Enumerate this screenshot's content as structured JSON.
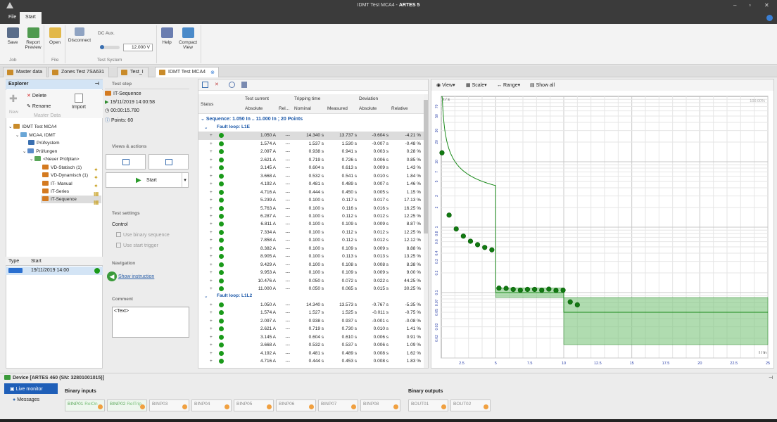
{
  "window": {
    "title_prefix": "IDMT Test MCA4 - ",
    "title_app": "ARTES 5"
  },
  "ribbon_tabs": [
    "File",
    "Start"
  ],
  "ribbon": {
    "save": "Save",
    "report": "Report\nPreview",
    "open": "Open",
    "disconnect": "Disconnect",
    "dcaux": "DC Aux.",
    "voltage": "12.000 V",
    "help": "Help",
    "compact": "Compact\nView",
    "groups": {
      "job": "Job",
      "file": "File",
      "test_system": "Test System"
    }
  },
  "doc_tabs": [
    "Master data",
    "Zones Test 7SA631",
    "Test_I",
    "IDMT Test MCA4"
  ],
  "explorer": {
    "title": "Explorer",
    "delete": "Delete",
    "rename": "Rename",
    "new": "New",
    "master_data": "Master Data",
    "import": "Import",
    "tree": [
      "IDMT Test MCA4",
      "MCA4, IDMT",
      "Prüfsystem",
      "Prüfungen",
      "<Neuer Prüfplan>",
      "VD-Statisch (1)",
      "VD-Dynamisch (1)",
      "IT- Manual",
      "IT-Series",
      "IT-Sequence"
    ],
    "list_head": {
      "type": "Type",
      "start": "Start"
    },
    "list_row": "19/11/2019 14:00"
  },
  "teststep": {
    "title": "Test step",
    "name": "IT-Sequence",
    "date": "19/11/2019 14:00:58",
    "time": "00:00:15.780",
    "points": "Points: 60"
  },
  "views": {
    "title": "Views & actions",
    "start": "Start"
  },
  "settings": {
    "title": "Test settings",
    "control": "Control",
    "binary": "Use binary sequence",
    "trigger": "Use start trigger"
  },
  "navigation": {
    "title": "Navigation",
    "show": "Show instruction"
  },
  "comment": {
    "title": "Comment",
    "text": "<Text>"
  },
  "table": {
    "status": "Status",
    "test_current": "Test current",
    "tripping_time": "Tripping time",
    "deviation": "Deviation",
    "absolute": "Absolute",
    "rel": "Rel...",
    "nominal": "Nominal",
    "measured": "Measured",
    "relative": "Relative",
    "sequence": "Sequence: 1.050 In .. 11.000 In ; 20 Points",
    "group1": "Fault loop: L1E",
    "group2": "Fault loop: L1L2",
    "rows1": [
      [
        "1.050 A",
        "14.340 s",
        "13.737 s",
        "-0.604 s",
        "-4.21 %"
      ],
      [
        "1.574 A",
        "1.537 s",
        "1.530 s",
        "-0.007 s",
        "-0.48 %"
      ],
      [
        "2.097 A",
        "0.938 s",
        "0.941 s",
        "0.003 s",
        "0.28 %"
      ],
      [
        "2.621 A",
        "0.719 s",
        "0.726 s",
        "0.006 s",
        "0.85 %"
      ],
      [
        "3.145 A",
        "0.604 s",
        "0.613 s",
        "0.009 s",
        "1.43 %"
      ],
      [
        "3.668 A",
        "0.532 s",
        "0.541 s",
        "0.010 s",
        "1.84 %"
      ],
      [
        "4.192 A",
        "0.481 s",
        "0.489 s",
        "0.007 s",
        "1.46 %"
      ],
      [
        "4.716 A",
        "0.444 s",
        "0.450 s",
        "0.005 s",
        "1.15 %"
      ],
      [
        "5.239 A",
        "0.100 s",
        "0.117 s",
        "0.017 s",
        "17.13 %"
      ],
      [
        "5.763 A",
        "0.100 s",
        "0.116 s",
        "0.016 s",
        "16.25 %"
      ],
      [
        "6.287 A",
        "0.100 s",
        "0.112 s",
        "0.012 s",
        "12.25 %"
      ],
      [
        "6.811 A",
        "0.100 s",
        "0.109 s",
        "0.009 s",
        "8.87 %"
      ],
      [
        "7.334 A",
        "0.100 s",
        "0.112 s",
        "0.012 s",
        "12.25 %"
      ],
      [
        "7.858 A",
        "0.100 s",
        "0.112 s",
        "0.012 s",
        "12.12 %"
      ],
      [
        "8.382 A",
        "0.100 s",
        "0.109 s",
        "0.009 s",
        "8.88 %"
      ],
      [
        "8.905 A",
        "0.100 s",
        "0.113 s",
        "0.013 s",
        "13.25 %"
      ],
      [
        "9.429 A",
        "0.100 s",
        "0.108 s",
        "0.008 s",
        "8.38 %"
      ],
      [
        "9.953 A",
        "0.100 s",
        "0.109 s",
        "0.009 s",
        "9.00 %"
      ],
      [
        "10.476 A",
        "0.050 s",
        "0.072 s",
        "0.022 s",
        "44.25 %"
      ],
      [
        "11.000 A",
        "0.050 s",
        "0.065 s",
        "0.015 s",
        "30.25 %"
      ]
    ],
    "rows2": [
      [
        "1.050 A",
        "14.340 s",
        "13.573 s",
        "-0.767 s",
        "-5.35 %"
      ],
      [
        "1.574 A",
        "1.527 s",
        "1.525 s",
        "-0.011 s",
        "-0.75 %"
      ],
      [
        "2.097 A",
        "0.938 s",
        "0.937 s",
        "-0.001 s",
        "-0.08 %"
      ],
      [
        "2.621 A",
        "0.719 s",
        "0.730 s",
        "0.010 s",
        "1.41 %"
      ],
      [
        "3.145 A",
        "0.604 s",
        "0.610 s",
        "0.006 s",
        "0.91 %"
      ],
      [
        "3.668 A",
        "0.532 s",
        "0.537 s",
        "0.006 s",
        "1.09 %"
      ],
      [
        "4.192 A",
        "0.481 s",
        "0.489 s",
        "0.008 s",
        "1.62 %"
      ],
      [
        "4.716 A",
        "0.444 s",
        "0.453 s",
        "0.008 s",
        "1.83 %"
      ]
    ],
    "dash": "---"
  },
  "chart_toolbar": {
    "view": "View",
    "scale": "Scale",
    "range": "Range",
    "show_all": "Show all"
  },
  "chart_data": {
    "type": "scatter",
    "title": "",
    "xlabel": "I / In",
    "ylabel": "t / s",
    "zoom": "100.00%",
    "xlim": [
      1,
      25
    ],
    "ylim": [
      0.01,
      100
    ],
    "log_y": true,
    "xticks": [
      "2.5",
      "5",
      "7.5",
      "10",
      "12.5",
      "15",
      "17.5",
      "20",
      "22.5",
      "25"
    ],
    "yticks": [
      "70",
      "50",
      "30",
      "20",
      "10",
      "7",
      "5",
      "3",
      "2",
      "1",
      "0.8",
      "0.6",
      "0.4",
      "0.3",
      "0.2",
      "0.1",
      "0.07",
      "0.05",
      "0.03",
      "0.02"
    ],
    "points": [
      [
        1.05,
        13.7
      ],
      [
        1.574,
        1.53
      ],
      [
        2.097,
        0.94
      ],
      [
        2.621,
        0.73
      ],
      [
        3.145,
        0.61
      ],
      [
        3.668,
        0.54
      ],
      [
        4.192,
        0.49
      ],
      [
        4.716,
        0.45
      ],
      [
        5.239,
        0.117
      ],
      [
        5.763,
        0.116
      ],
      [
        6.287,
        0.112
      ],
      [
        6.811,
        0.109
      ],
      [
        7.334,
        0.112
      ],
      [
        7.858,
        0.112
      ],
      [
        8.382,
        0.109
      ],
      [
        8.905,
        0.113
      ],
      [
        9.429,
        0.108
      ],
      [
        9.953,
        0.109
      ],
      [
        10.476,
        0.072
      ],
      [
        11.0,
        0.065
      ]
    ],
    "curve_color": "#1a8a1a",
    "band_color": "#7cc47c"
  },
  "device": {
    "title": "Device [ARTES 460 (SN: 32801001015)]",
    "live": "Live monitor",
    "messages": "Messages",
    "binary_inputs": "Binary inputs",
    "binary_outputs": "Binary outputs",
    "inputs": [
      [
        "BINP01",
        "RelOn"
      ],
      [
        "BINP02",
        "RelTrip"
      ],
      [
        "BINP03",
        ""
      ],
      [
        "BINP04",
        ""
      ],
      [
        "BINP05",
        ""
      ],
      [
        "BINP06",
        ""
      ],
      [
        "BINP07",
        ""
      ],
      [
        "BINP08",
        ""
      ]
    ],
    "outputs": [
      "BOUT01",
      "BOUT02"
    ]
  }
}
